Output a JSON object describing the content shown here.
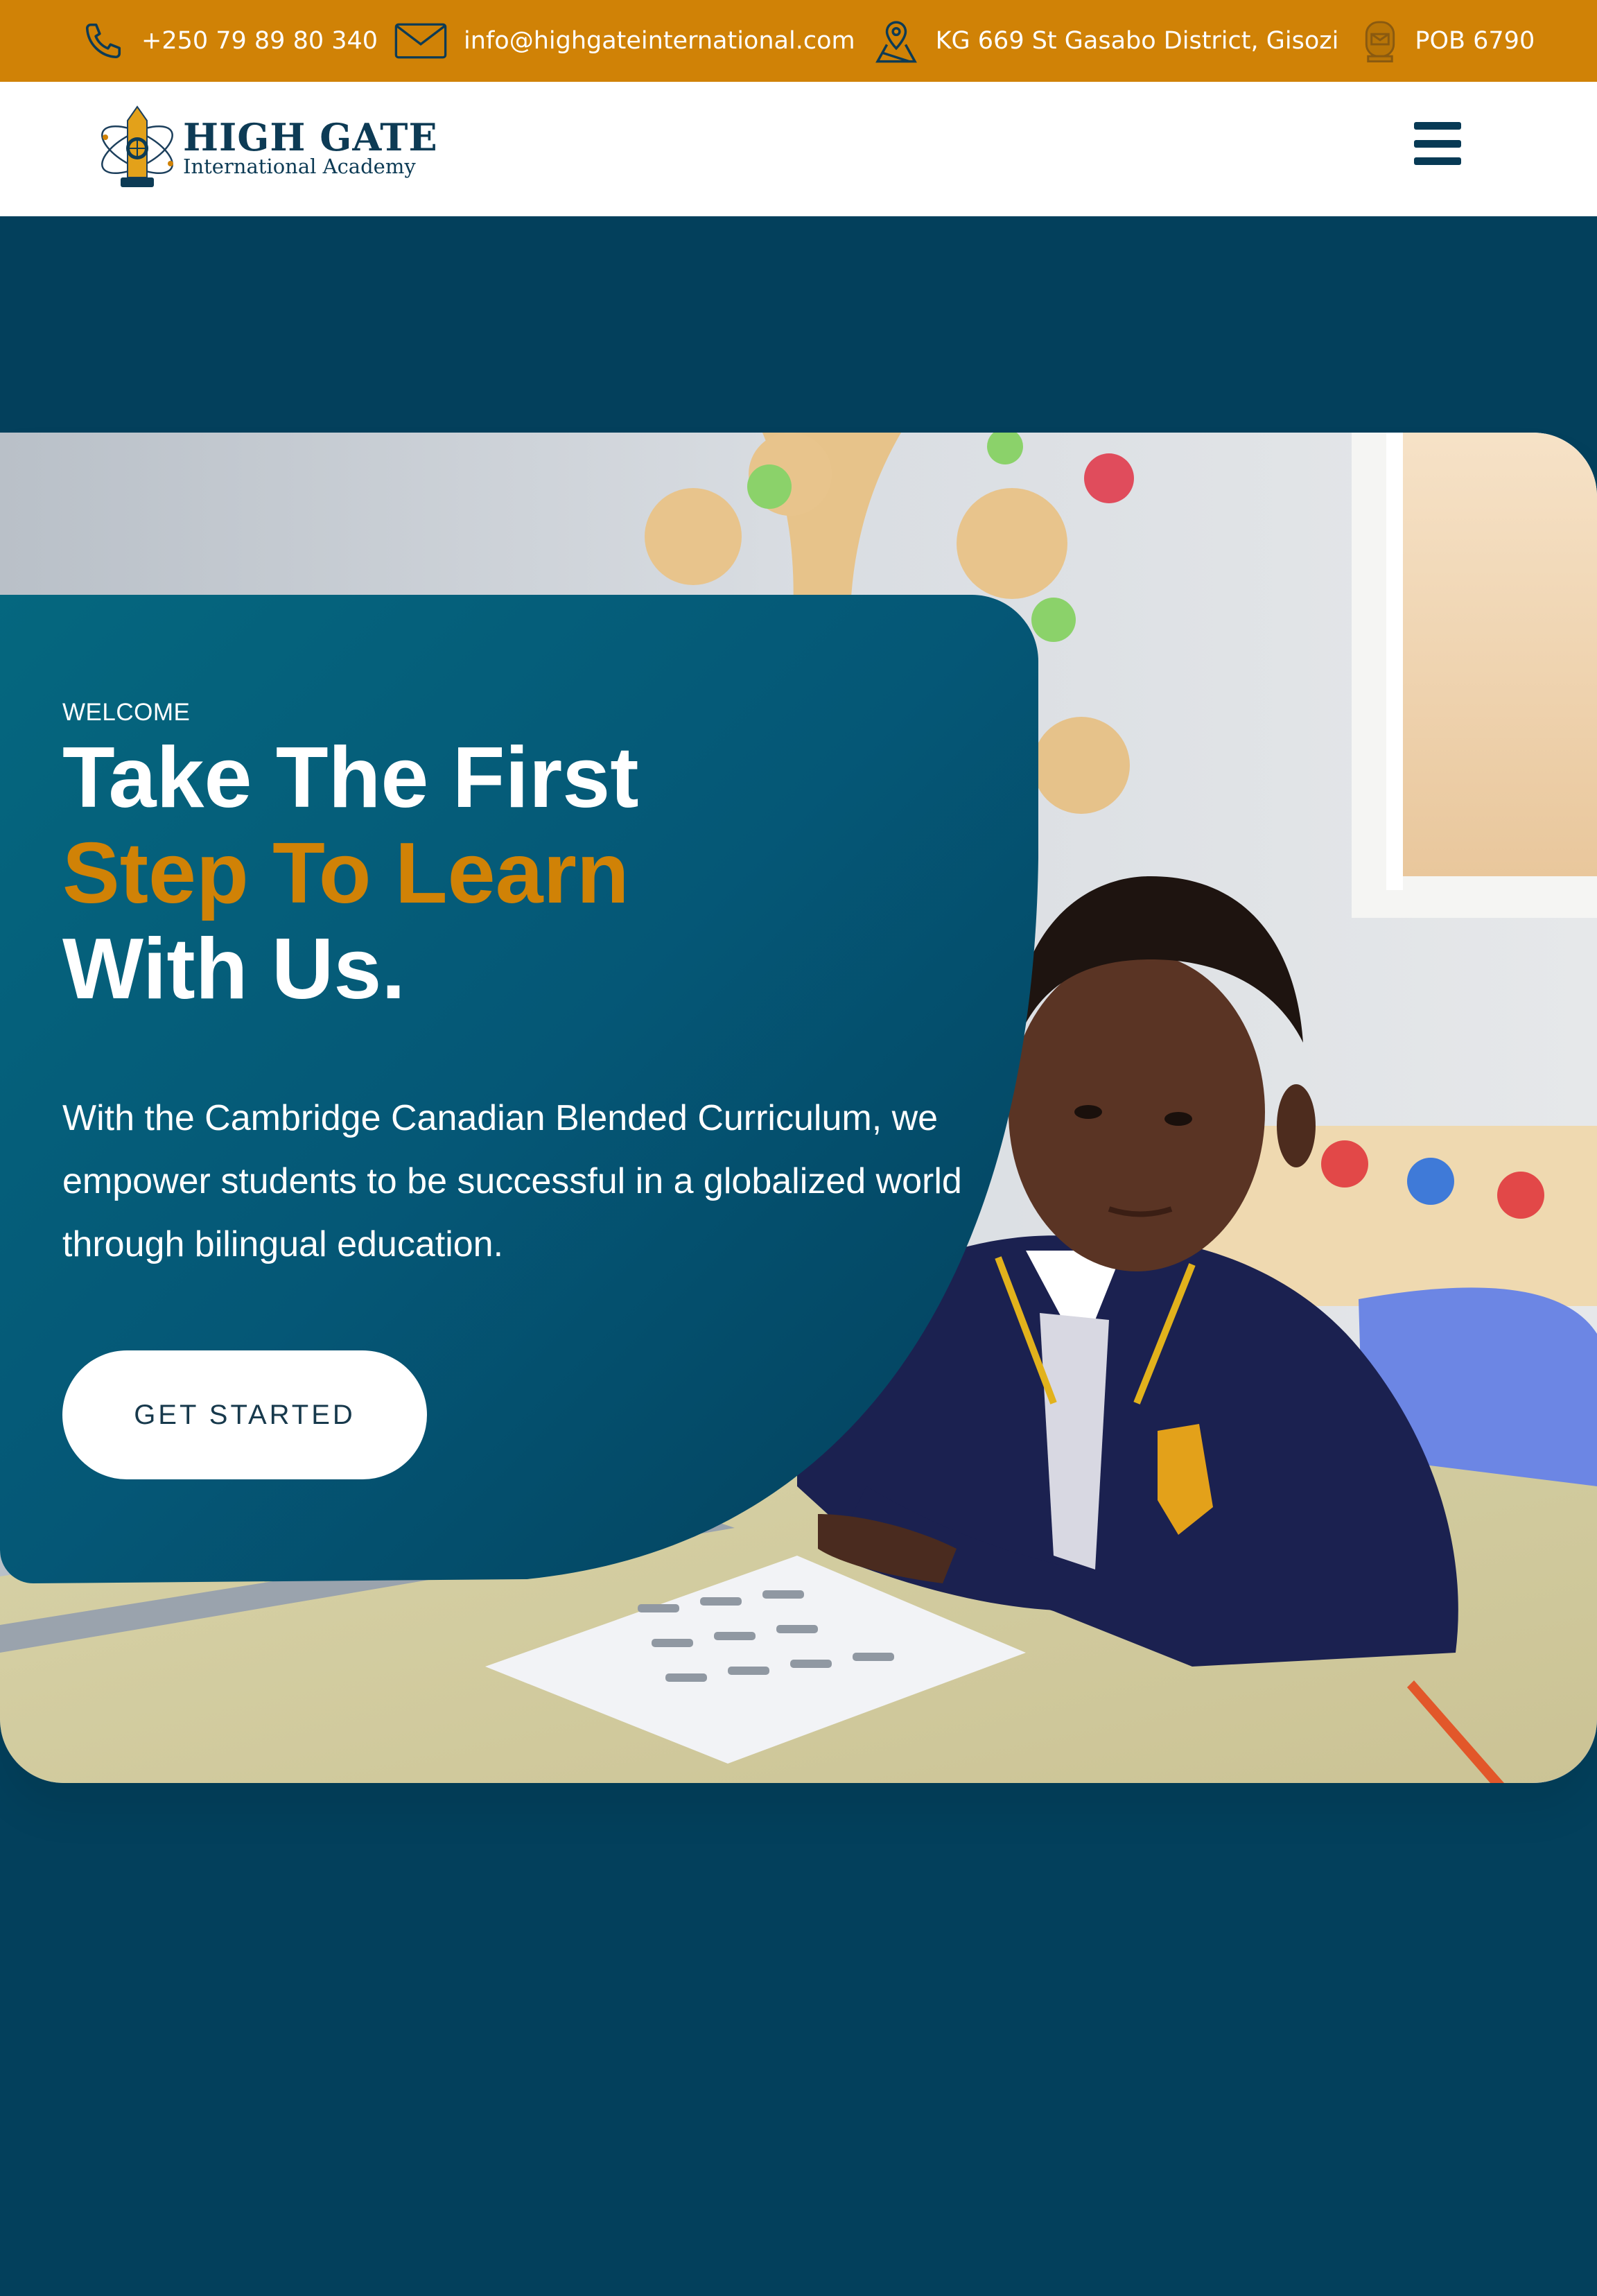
{
  "topbar": {
    "phone": "+250 79 89 80 340",
    "email": "info@highgateinternational.com",
    "address": "KG 669 St Gasabo District, Gisozi",
    "pobox": "POB 6790",
    "icons": [
      "phone-icon",
      "mail-icon",
      "map-pin-icon",
      "mailbox-icon"
    ],
    "background": "#d08206"
  },
  "header": {
    "logo_title": "HIGH GATE",
    "logo_subtitle": "International Academy",
    "menu_icon": "hamburger-menu-icon"
  },
  "hero": {
    "eyebrow": "WELCOME",
    "headline_line1": "Take The First",
    "headline_line2": "Step To Learn",
    "headline_line3": "With Us.",
    "description": "With the Cambridge Canadian Blended Curriculum, we empower students to be successful in a globalized world through bilingual education.",
    "cta_label": "GET STARTED"
  },
  "colors": {
    "primary": "#03405c",
    "accent": "#d08206",
    "card_gradient_start": "#05677f",
    "white": "#ffffff"
  }
}
